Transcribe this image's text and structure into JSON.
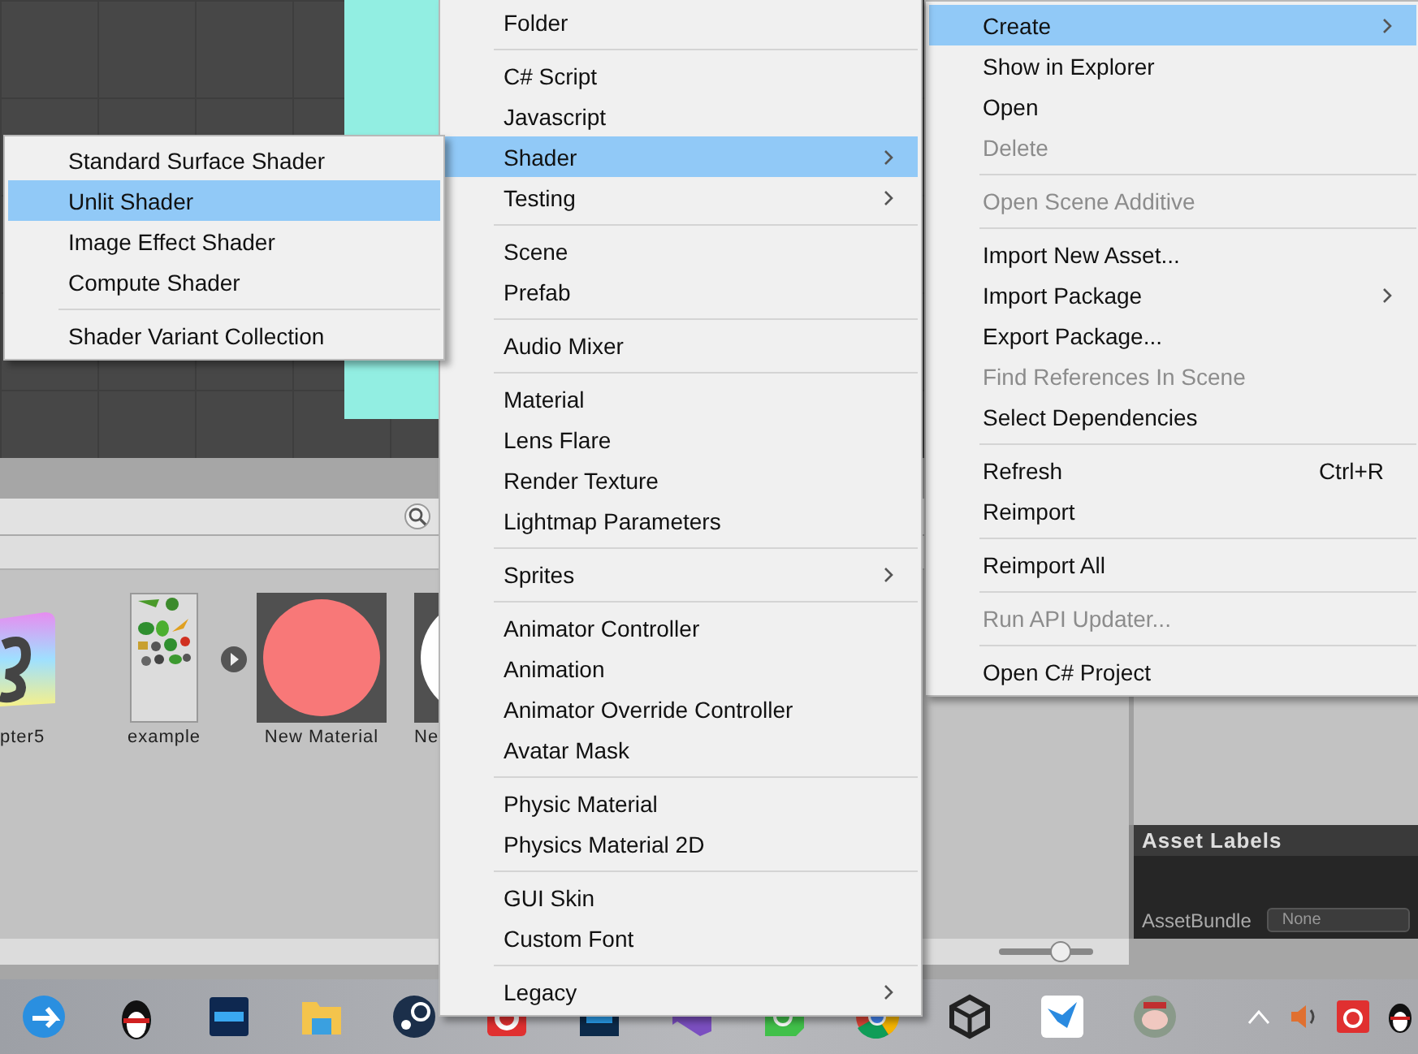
{
  "project": {
    "assets": [
      {
        "kind": "script-file",
        "label": "pter5"
      },
      {
        "kind": "sprite-sheet",
        "label": "example",
        "expander": true
      },
      {
        "kind": "material",
        "label": "New Material",
        "color": "#f87878"
      },
      {
        "kind": "material",
        "label": "Ne",
        "color": "#ffffff"
      }
    ]
  },
  "zoom_slider": {
    "level": 0.68
  },
  "asset_labels": {
    "title": "Asset Labels",
    "field_label": "AssetBundle",
    "value": "None"
  },
  "context_menu": {
    "items": [
      {
        "kind": "item",
        "label": "Create",
        "selected": true,
        "disabled": false,
        "arrow": true
      },
      {
        "kind": "item",
        "label": "Show in Explorer",
        "selected": false,
        "disabled": false
      },
      {
        "kind": "item",
        "label": "Open",
        "selected": false,
        "disabled": false
      },
      {
        "kind": "item",
        "label": "Delete",
        "selected": false,
        "disabled": true
      },
      {
        "kind": "separator"
      },
      {
        "kind": "item",
        "label": "Open Scene Additive",
        "selected": false,
        "disabled": true
      },
      {
        "kind": "separator"
      },
      {
        "kind": "item",
        "label": "Import New Asset...",
        "selected": false,
        "disabled": false
      },
      {
        "kind": "item",
        "label": "Import Package",
        "selected": false,
        "disabled": false,
        "arrow": true
      },
      {
        "kind": "item",
        "label": "Export Package...",
        "selected": false,
        "disabled": false
      },
      {
        "kind": "item",
        "label": "Find References In Scene",
        "selected": false,
        "disabled": true
      },
      {
        "kind": "item",
        "label": "Select Dependencies",
        "selected": false,
        "disabled": false
      },
      {
        "kind": "separator"
      },
      {
        "kind": "item",
        "label": "Refresh",
        "selected": false,
        "disabled": false,
        "shortcut": "Ctrl+R"
      },
      {
        "kind": "item",
        "label": "Reimport",
        "selected": false,
        "disabled": false
      },
      {
        "kind": "separator"
      },
      {
        "kind": "item",
        "label": "Reimport All",
        "selected": false,
        "disabled": false
      },
      {
        "kind": "separator"
      },
      {
        "kind": "item",
        "label": "Run API Updater...",
        "selected": false,
        "disabled": true
      },
      {
        "kind": "separator"
      },
      {
        "kind": "item",
        "label": "Open C# Project",
        "selected": false,
        "disabled": false
      }
    ]
  },
  "create_menu": {
    "items": [
      {
        "kind": "item",
        "label": "Folder",
        "selected": false,
        "disabled": false
      },
      {
        "kind": "separator"
      },
      {
        "kind": "item",
        "label": "C# Script",
        "selected": false,
        "disabled": false
      },
      {
        "kind": "item",
        "label": "Javascript",
        "selected": false,
        "disabled": false
      },
      {
        "kind": "item",
        "label": "Shader",
        "selected": true,
        "disabled": false,
        "arrow": true
      },
      {
        "kind": "item",
        "label": "Testing",
        "selected": false,
        "disabled": false,
        "arrow": true
      },
      {
        "kind": "separator"
      },
      {
        "kind": "item",
        "label": "Scene",
        "selected": false,
        "disabled": false
      },
      {
        "kind": "item",
        "label": "Prefab",
        "selected": false,
        "disabled": false
      },
      {
        "kind": "separator"
      },
      {
        "kind": "item",
        "label": "Audio Mixer",
        "selected": false,
        "disabled": false
      },
      {
        "kind": "separator"
      },
      {
        "kind": "item",
        "label": "Material",
        "selected": false,
        "disabled": false
      },
      {
        "kind": "item",
        "label": "Lens Flare",
        "selected": false,
        "disabled": false
      },
      {
        "kind": "item",
        "label": "Render Texture",
        "selected": false,
        "disabled": false
      },
      {
        "kind": "item",
        "label": "Lightmap Parameters",
        "selected": false,
        "disabled": false
      },
      {
        "kind": "separator"
      },
      {
        "kind": "item",
        "label": "Sprites",
        "selected": false,
        "disabled": false,
        "arrow": true
      },
      {
        "kind": "separator"
      },
      {
        "kind": "item",
        "label": "Animator Controller",
        "selected": false,
        "disabled": false
      },
      {
        "kind": "item",
        "label": "Animation",
        "selected": false,
        "disabled": false
      },
      {
        "kind": "item",
        "label": "Animator Override Controller",
        "selected": false,
        "disabled": false
      },
      {
        "kind": "item",
        "label": "Avatar Mask",
        "selected": false,
        "disabled": false
      },
      {
        "kind": "separator"
      },
      {
        "kind": "item",
        "label": "Physic Material",
        "selected": false,
        "disabled": false
      },
      {
        "kind": "item",
        "label": "Physics Material 2D",
        "selected": false,
        "disabled": false
      },
      {
        "kind": "separator"
      },
      {
        "kind": "item",
        "label": "GUI Skin",
        "selected": false,
        "disabled": false
      },
      {
        "kind": "item",
        "label": "Custom Font",
        "selected": false,
        "disabled": false
      },
      {
        "kind": "separator"
      },
      {
        "kind": "item",
        "label": "Legacy",
        "selected": false,
        "disabled": false,
        "arrow": true
      }
    ]
  },
  "shader_menu": {
    "items": [
      {
        "kind": "item",
        "label": "Standard Surface Shader",
        "selected": false,
        "disabled": false
      },
      {
        "kind": "item",
        "label": "Unlit Shader",
        "selected": true,
        "disabled": false
      },
      {
        "kind": "item",
        "label": "Image Effect Shader",
        "selected": false,
        "disabled": false
      },
      {
        "kind": "item",
        "label": "Compute Shader",
        "selected": false,
        "disabled": false
      },
      {
        "kind": "separator"
      },
      {
        "kind": "item",
        "label": "Shader Variant Collection",
        "selected": false,
        "disabled": false
      }
    ]
  }
}
